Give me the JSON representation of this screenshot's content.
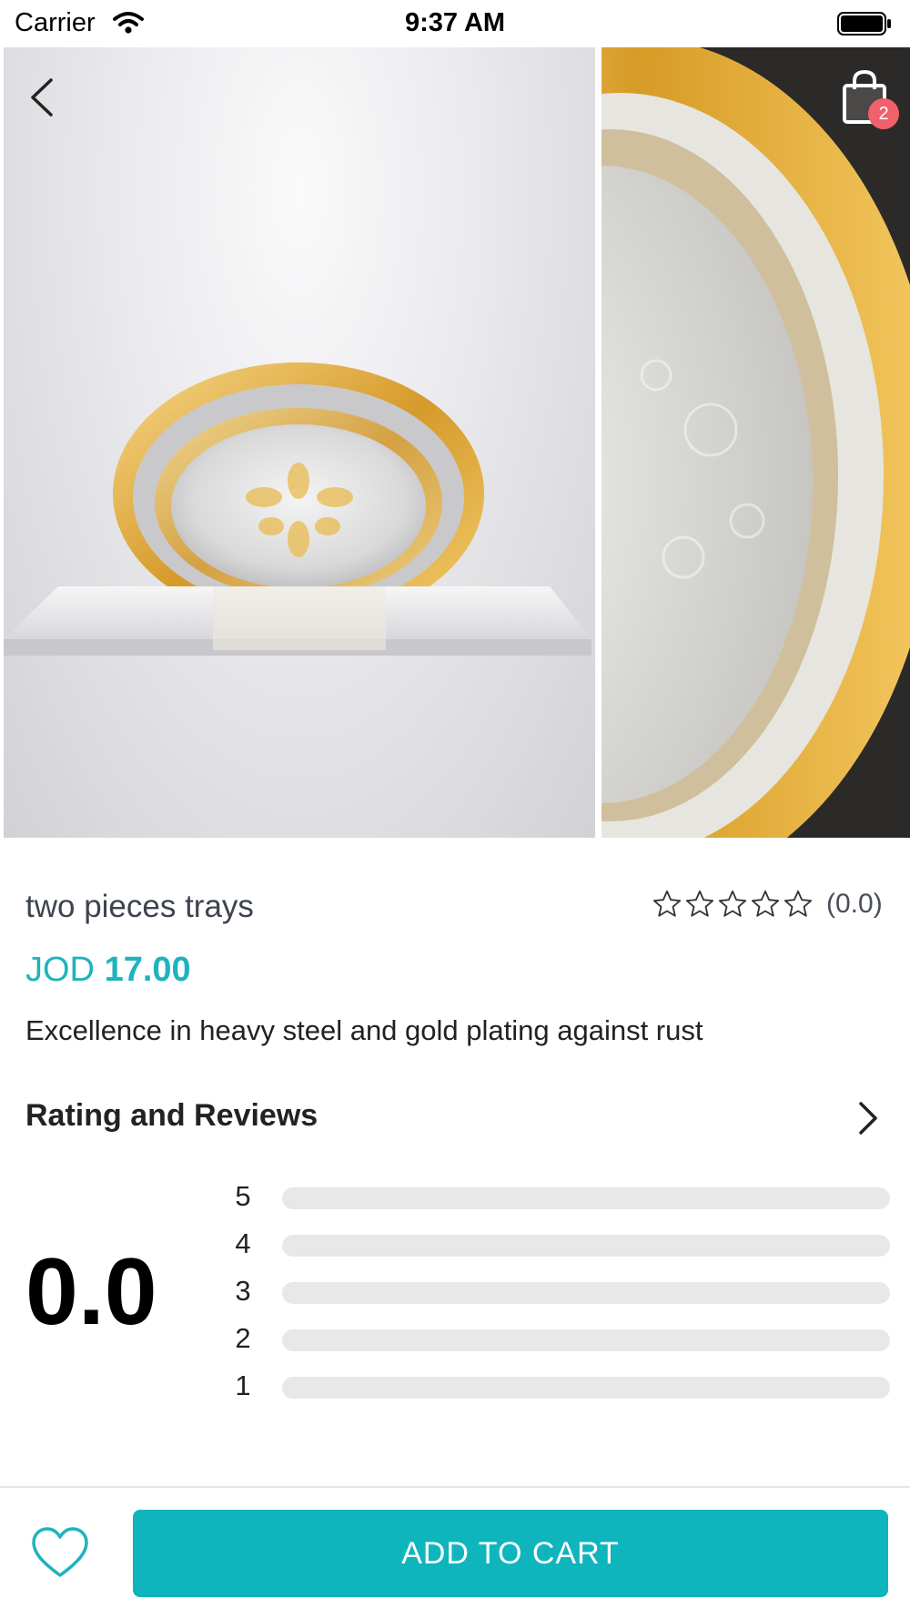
{
  "status_bar": {
    "carrier": "Carrier",
    "time": "9:37 AM"
  },
  "header": {
    "cart_badge": "2"
  },
  "product": {
    "name": "two pieces trays",
    "rating": 0,
    "rating_count_text": "(0.0)",
    "price_currency": "JOD",
    "price_amount": "17.00",
    "description": "Excellence in heavy steel and gold plating against rust"
  },
  "reviews": {
    "heading": "Rating and Reviews",
    "average": "0.0",
    "distribution": [
      {
        "label": "5",
        "fraction": 0
      },
      {
        "label": "4",
        "fraction": 0
      },
      {
        "label": "3",
        "fraction": 0
      },
      {
        "label": "2",
        "fraction": 0
      },
      {
        "label": "1",
        "fraction": 0
      }
    ]
  },
  "actions": {
    "add_to_cart": "ADD TO CART"
  },
  "colors": {
    "accent": "#0fb5bd",
    "badge": "#f0616b",
    "bar_track": "#e6e8ea"
  }
}
